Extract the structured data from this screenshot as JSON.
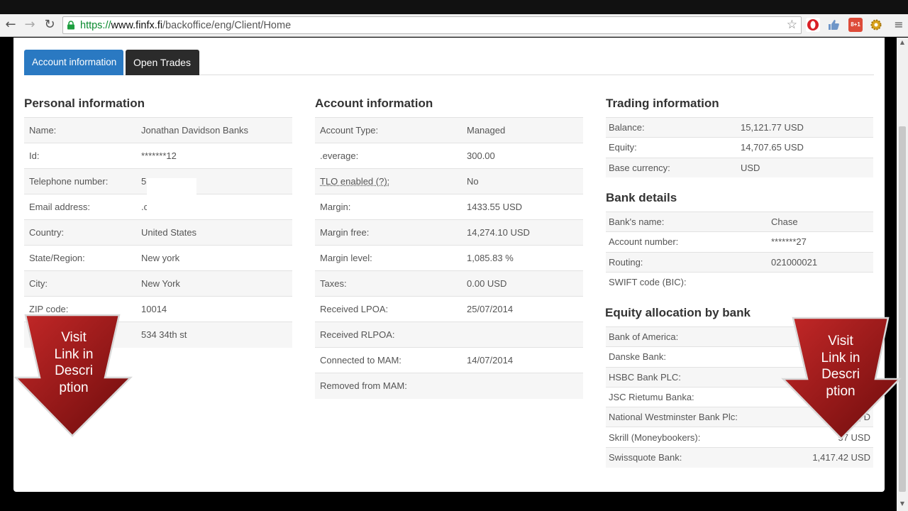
{
  "browser": {
    "url_scheme": "https://",
    "url_host": "www.finfx.fi",
    "url_path": "/backoffice/eng/Client/Home",
    "ext_gplus": "8+1"
  },
  "tabs": [
    {
      "label": "Account information",
      "active": true
    },
    {
      "label": "Open Trades",
      "active": false
    }
  ],
  "personal": {
    "title": "Personal information",
    "rows": [
      {
        "label": "Name:",
        "value": "Jonathan Davidson Banks"
      },
      {
        "label": "Id:",
        "value": "*******12"
      },
      {
        "label": "Telephone number:",
        "value": "55"
      },
      {
        "label": "Email address:",
        "value": ".com"
      },
      {
        "label": "Country:",
        "value": "United States"
      },
      {
        "label": "State/Region:",
        "value": "New york"
      },
      {
        "label": "City:",
        "value": "New York"
      },
      {
        "label": "ZIP code:",
        "value": "10014"
      },
      {
        "label": "",
        "value": "534 34th st"
      }
    ]
  },
  "account": {
    "title": "Account information",
    "rows": [
      {
        "label": "Account Type:",
        "value": "Managed"
      },
      {
        "label": ".everage:",
        "value": "300.00"
      },
      {
        "label": "TLO enabled (?):",
        "value": "No"
      },
      {
        "label": "Margin:",
        "value": "1433.55 USD"
      },
      {
        "label": "Margin free:",
        "value": "14,274.10 USD"
      },
      {
        "label": "Margin level:",
        "value": "1,085.83 %"
      },
      {
        "label": "Taxes:",
        "value": "0.00 USD"
      },
      {
        "label": "Received LPOA:",
        "value": "25/07/2014"
      },
      {
        "label": "Received RLPOA:",
        "value": ""
      },
      {
        "label": "Connected to MAM:",
        "value": "14/07/2014"
      },
      {
        "label": "Removed from MAM:",
        "value": ""
      }
    ]
  },
  "trading": {
    "title": "Trading information",
    "rows": [
      {
        "label": "Balance:",
        "value": "15,121.77 USD"
      },
      {
        "label": "Equity:",
        "value": "14,707.65 USD"
      },
      {
        "label": "Base currency:",
        "value": "USD"
      }
    ]
  },
  "bank": {
    "title": "Bank details",
    "rows": [
      {
        "label": "Bank's name:",
        "value": "Chase"
      },
      {
        "label": "Account number:",
        "value": "*******27"
      },
      {
        "label": "Routing:",
        "value": "021000021"
      },
      {
        "label": "SWIFT code (BIC):",
        "value": ""
      }
    ]
  },
  "equity_alloc": {
    "title": "Equity allocation by bank",
    "rows": [
      {
        "label": "Bank of America:",
        "value": ""
      },
      {
        "label": "Danske Bank:",
        "value": ""
      },
      {
        "label": "HSBC Bank PLC:",
        "value": ""
      },
      {
        "label": "JSC Rietumu Banka:",
        "value": ""
      },
      {
        "label": "National Westminster Bank Plc:",
        "value": "1,   D"
      },
      {
        "label": "Skrill (Moneybookers):",
        "value": "57   USD"
      },
      {
        "label": "Swissquote Bank:",
        "value": "1,417.42 USD"
      }
    ]
  },
  "overlay": {
    "left_arrow_text": "Visit\nLink in\nDescri\nption",
    "right_arrow_text": "Visit\nLink in\nDescri\nption",
    "arrow_color": "#a01c1c"
  }
}
